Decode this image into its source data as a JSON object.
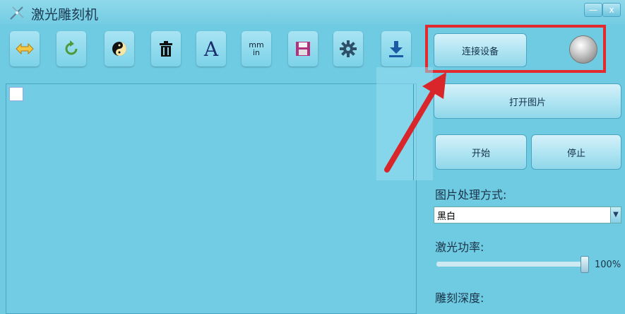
{
  "window": {
    "title": "激光雕刻机",
    "minimize_glyph": "—",
    "close_glyph": "x"
  },
  "toolbar": [
    {
      "name": "mirror-icon"
    },
    {
      "name": "rotate-icon"
    },
    {
      "name": "yin-yang-icon"
    },
    {
      "name": "delete-icon"
    },
    {
      "name": "text-icon",
      "glyph": "A"
    },
    {
      "name": "unit-icon",
      "top": "mm",
      "bottom": "in"
    },
    {
      "name": "save-icon"
    },
    {
      "name": "settings-icon"
    },
    {
      "name": "download-icon"
    }
  ],
  "connect_button": "连接设备",
  "open_image_button": "打开图片",
  "start_button": "开始",
  "stop_button": "停止",
  "processing": {
    "label": "图片处理方式:",
    "selected": "黑白"
  },
  "laser_power": {
    "label": "激光功率:",
    "value": "100%",
    "fraction": 1.0
  },
  "engrave_depth": {
    "label": "雕刻深度:"
  },
  "colors": {
    "background": "#6fcbe2",
    "highlight": "#e12b2e",
    "arrow": "#d8262b"
  }
}
